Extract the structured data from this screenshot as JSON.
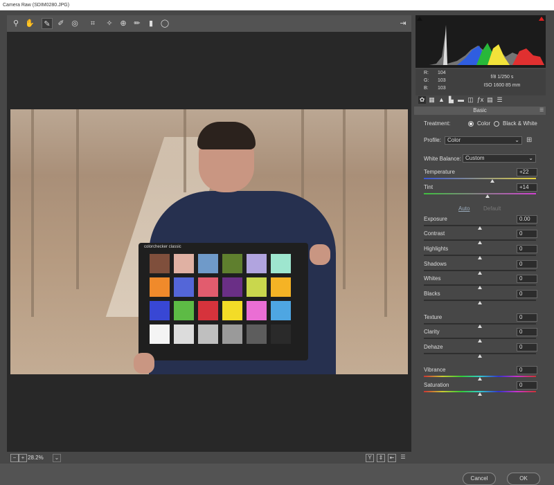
{
  "window": {
    "title": "Camera Raw (SDIM0280.JPG)"
  },
  "toolbar": {
    "tools": [
      {
        "icon": "zoom-icon",
        "glyph": "⚲"
      },
      {
        "icon": "hand-icon",
        "glyph": "✋"
      },
      {
        "icon": "white-balance-icon",
        "glyph": "✎"
      },
      {
        "icon": "color-sampler-icon",
        "glyph": "✐"
      },
      {
        "icon": "targeted-adjustment-icon",
        "glyph": "◎"
      },
      {
        "icon": "crop-icon",
        "glyph": "⌗"
      },
      {
        "icon": "spot-removal-icon",
        "glyph": "✧"
      },
      {
        "icon": "red-eye-icon",
        "glyph": "⊕"
      },
      {
        "icon": "adjustment-brush-icon",
        "glyph": "✏"
      },
      {
        "icon": "graduated-filter-icon",
        "glyph": "▮"
      },
      {
        "icon": "radial-filter-icon",
        "glyph": "◯"
      }
    ],
    "fullscreen_icon": "fullscreen-icon"
  },
  "color_checker": {
    "brand": "colorchecker classic",
    "swatches": [
      "#7f4f3c",
      "#e0b1a3",
      "#6f9ac9",
      "#5f7f2e",
      "#b1a4df",
      "#9ee6cf",
      "#f08a2b",
      "#5466d8",
      "#e25c6e",
      "#6a2f86",
      "#c9d74d",
      "#f5b325",
      "#3847d4",
      "#5dbb45",
      "#d6333c",
      "#f3dc27",
      "#ea6ed4",
      "#4ea6e2",
      "#f4f4f4",
      "#dcdcdc",
      "#bfbfbf",
      "#9a9a9a",
      "#5d5d5d",
      "#2a2a2a"
    ]
  },
  "statusbar": {
    "zoom": "28.2%"
  },
  "buttons": {
    "cancel": "Cancel",
    "ok": "OK"
  },
  "histogram": {
    "r": "104",
    "g": "103",
    "b": "103",
    "r_label": "R:",
    "g_label": "G:",
    "b_label": "B:",
    "aperture_shutter": "f/8   1/250 s",
    "iso_focal": "ISO 1600   85 mm"
  },
  "panel": {
    "section": "Basic",
    "treatment_label": "Treatment:",
    "treatment_color": "Color",
    "treatment_bw": "Black & White",
    "profile_label": "Profile:",
    "profile_value": "Color",
    "wb_label": "White Balance:",
    "wb_value": "Custom",
    "auto": "Auto",
    "default": "Default"
  },
  "sliders": [
    {
      "label": "Temperature",
      "value": "+22",
      "level": 0.61,
      "gradient": "temp"
    },
    {
      "label": "Tint",
      "value": "+14",
      "level": 0.57,
      "gradient": "tint"
    },
    {
      "label": "Exposure",
      "value": "0.00",
      "level": 0.5
    },
    {
      "label": "Contrast",
      "value": "0",
      "level": 0.5
    },
    {
      "label": "Highlights",
      "value": "0",
      "level": 0.5
    },
    {
      "label": "Shadows",
      "value": "0",
      "level": 0.5
    },
    {
      "label": "Whites",
      "value": "0",
      "level": 0.5
    },
    {
      "label": "Blacks",
      "value": "0",
      "level": 0.5
    },
    {
      "label": "Texture",
      "value": "0",
      "level": 0.5
    },
    {
      "label": "Clarity",
      "value": "0",
      "level": 0.5
    },
    {
      "label": "Dehaze",
      "value": "0",
      "level": 0.5
    },
    {
      "label": "Vibrance",
      "value": "0",
      "level": 0.5,
      "gradient": "spectrum"
    },
    {
      "label": "Saturation",
      "value": "0",
      "level": 0.5,
      "gradient": "spectrum"
    }
  ]
}
